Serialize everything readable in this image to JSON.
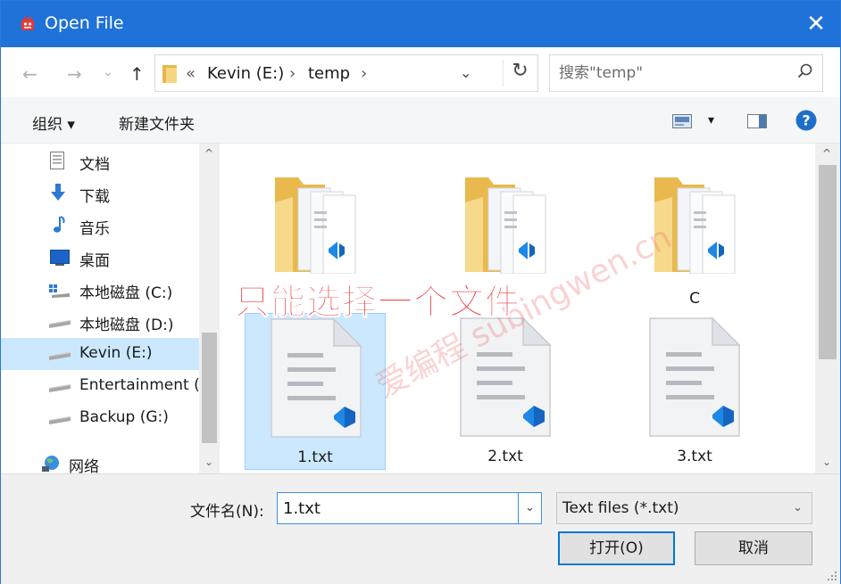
{
  "window": {
    "title": "Open File",
    "close_glyph": "✕"
  },
  "nav": {
    "back": "←",
    "forward": "→",
    "recent": "⌄",
    "up": "↑"
  },
  "address": {
    "overflow": "«",
    "crumbs": [
      "Kevin (E:)",
      "temp"
    ],
    "sep": "›",
    "drop": "⌄",
    "refresh": "↻"
  },
  "search": {
    "placeholder": "搜索\"temp\""
  },
  "toolbar": {
    "organize": "组织 ▾",
    "new_folder": "新建文件夹",
    "view_drop": "▾",
    "help": "?"
  },
  "sidebar": {
    "items": [
      {
        "label": "文档",
        "icon": "document-icon"
      },
      {
        "label": "下载",
        "icon": "download-icon"
      },
      {
        "label": "音乐",
        "icon": "music-icon"
      },
      {
        "label": "桌面",
        "icon": "desktop-icon"
      },
      {
        "label": "本地磁盘 (C:)",
        "icon": "system-drive-icon"
      },
      {
        "label": "本地磁盘 (D:)",
        "icon": "drive-icon"
      },
      {
        "label": "Kevin (E:)",
        "icon": "drive-icon",
        "selected": true
      },
      {
        "label": "Entertainment (",
        "icon": "drive-icon"
      },
      {
        "label": "Backup (G:)",
        "icon": "drive-icon"
      },
      {
        "label": "网络",
        "icon": "network-icon"
      }
    ],
    "scroll_up": "^",
    "scroll_down": "⌄"
  },
  "files": {
    "folders": [
      {
        "name": ""
      },
      {
        "name": ""
      },
      {
        "name": "C"
      }
    ],
    "txt": [
      {
        "name": "1.txt",
        "selected": true
      },
      {
        "name": "2.txt"
      },
      {
        "name": "3.txt"
      }
    ],
    "scroll_up": "^",
    "scroll_down": "⌄"
  },
  "annotation": {
    "text": "只能选择一个文件",
    "watermark": "爱编程 subingwen.cn"
  },
  "bottom": {
    "filename_label": "文件名(N):",
    "filename_value": "1.txt",
    "filename_drop": "⌄",
    "filter_value": "Text files (*.txt)",
    "filter_drop": "⌄",
    "open_label": "打开(O)",
    "cancel_label": "取消"
  },
  "colors": {
    "accent": "#1f72d8",
    "selection": "#cce8ff",
    "annotation": "#e8252a"
  }
}
